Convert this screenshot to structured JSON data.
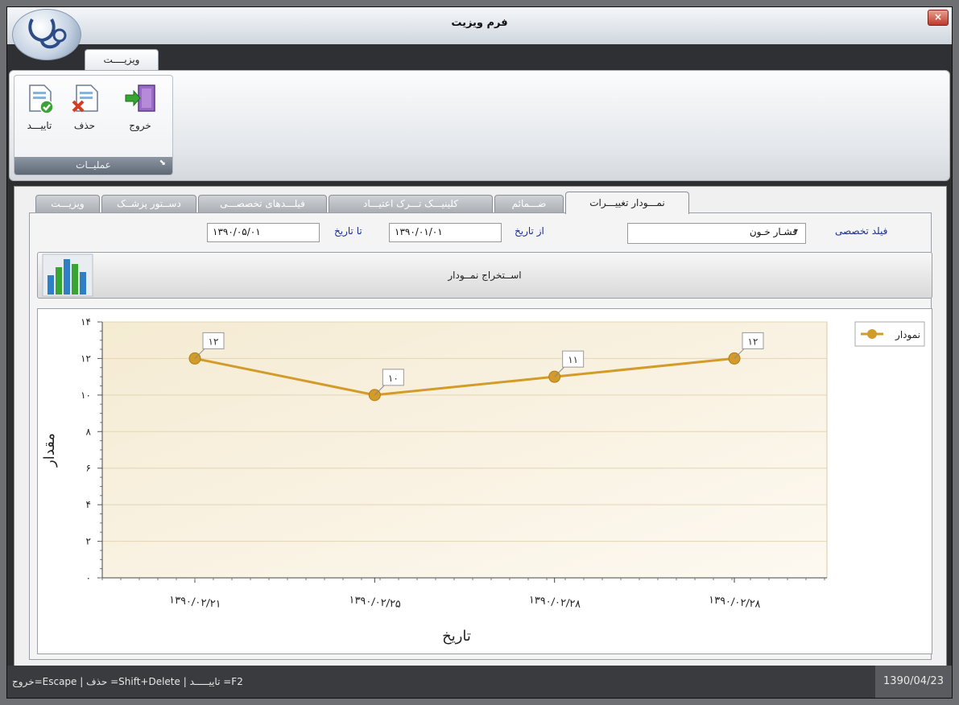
{
  "window": {
    "title": "فرم ویزیت",
    "close_glyph": "×"
  },
  "ribbon": {
    "tab_label": "ویزیــــت",
    "group_label": "عملیــات",
    "buttons": {
      "confirm": "تاییـــد",
      "delete": "حذف",
      "exit": "خروج"
    }
  },
  "tabs": [
    {
      "label": "نمـــودار تغییـــرات",
      "active": true
    },
    {
      "label": "ضـــمائم",
      "active": false
    },
    {
      "label": "کلینیـــک تـــرک اعتیـــاد",
      "active": false
    },
    {
      "label": "فیلـــدهای تخصصـــی",
      "active": false
    },
    {
      "label": "دســتور پزشــک",
      "active": false
    },
    {
      "label": "ویزیـــت",
      "active": false
    }
  ],
  "filters": {
    "specialty_label": "فیلد تخصصی",
    "specialty_value": "فشـار خـون",
    "from_label": "از تاریخ",
    "from_value": "۱۳۹۰/۰۱/۰۱",
    "to_label": "تا تاریخ",
    "to_value": "۱۳۹۰/۰۵/۰۱"
  },
  "extract_button": "اســتخراج نمــودار",
  "chart_data": {
    "type": "line",
    "categories": [
      "۱۳۹۰/۰۲/۲۱",
      "۱۳۹۰/۰۲/۲۵",
      "۱۳۹۰/۰۲/۲۸",
      "۱۳۹۰/۰۲/۲۸"
    ],
    "series": [
      {
        "name": "نمودار",
        "values": [
          12,
          10,
          11,
          12
        ],
        "labels": [
          "۱۲",
          "۱۰",
          "۱۱",
          "۱۲"
        ]
      }
    ],
    "series_color": "#d29b2a",
    "ylim": [
      0,
      14
    ],
    "yticks": [
      0,
      2,
      4,
      6,
      8,
      10,
      12,
      14
    ],
    "ytick_labels": [
      "۰",
      "۲",
      "۴",
      "۶",
      "۸",
      "۱۰",
      "۱۲",
      "۱۴"
    ],
    "xlabel": "تاریخ",
    "ylabel": "مقدار",
    "grid": true,
    "legend_position": "top-right"
  },
  "status": {
    "shortcuts": "خروج=Escape | حذف =Shift+Delete | تاییـــــد =F2",
    "date": "1390/04/23"
  }
}
